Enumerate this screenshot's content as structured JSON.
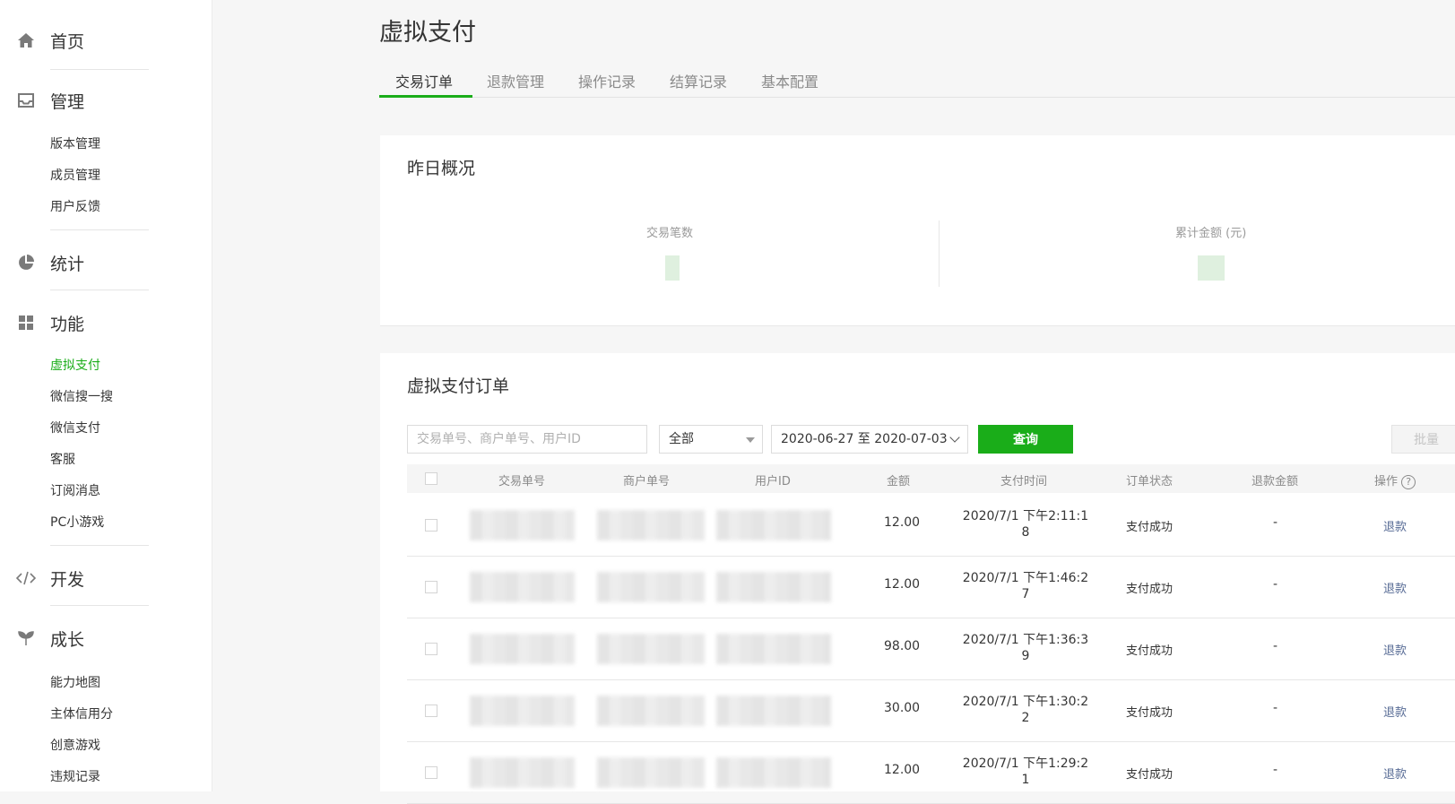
{
  "sidebar": {
    "home": {
      "label": "首页",
      "icon": "home-icon"
    },
    "manage": {
      "label": "管理",
      "icon": "inbox-icon",
      "items": [
        "版本管理",
        "成员管理",
        "用户反馈"
      ]
    },
    "stats": {
      "label": "统计",
      "icon": "pie-chart-icon"
    },
    "features": {
      "label": "功能",
      "icon": "grid-icon",
      "items": [
        "虚拟支付",
        "微信搜一搜",
        "微信支付",
        "客服",
        "订阅消息",
        "PC小游戏"
      ],
      "active": "虚拟支付"
    },
    "dev": {
      "label": "开发",
      "icon": "code-icon"
    },
    "growth": {
      "label": "成长",
      "icon": "sprout-icon",
      "items": [
        "能力地图",
        "主体信用分",
        "创意游戏",
        "违规记录"
      ]
    }
  },
  "page": {
    "title": "虚拟支付"
  },
  "tabs": [
    "交易订单",
    "退款管理",
    "操作记录",
    "结算记录",
    "基本配置"
  ],
  "overview": {
    "title": "昨日概况",
    "stats": [
      {
        "label": "交易笔数"
      },
      {
        "label": "累计金额 (元)"
      }
    ]
  },
  "orders": {
    "title": "虚拟支付订单",
    "search_placeholder": "交易单号、商户单号、用户ID",
    "status_filter": "全部",
    "date_range": "2020-06-27 至 2020-07-03",
    "query_label": "查询",
    "batch_label": "批量",
    "columns": [
      "交易单号",
      "商户单号",
      "用户ID",
      "金额",
      "支付时间",
      "订单状态",
      "退款金额",
      "操作"
    ],
    "rows": [
      {
        "amount": "12.00",
        "time_1": "2020/7/1 下午2:11:1",
        "time_2": "8",
        "status": "支付成功",
        "refund_amount": "-",
        "action": "退款"
      },
      {
        "amount": "12.00",
        "time_1": "2020/7/1 下午1:46:2",
        "time_2": "7",
        "status": "支付成功",
        "refund_amount": "-",
        "action": "退款"
      },
      {
        "amount": "98.00",
        "time_1": "2020/7/1 下午1:36:3",
        "time_2": "9",
        "status": "支付成功",
        "refund_amount": "-",
        "action": "退款"
      },
      {
        "amount": "30.00",
        "time_1": "2020/7/1 下午1:30:2",
        "time_2": "2",
        "status": "支付成功",
        "refund_amount": "-",
        "action": "退款"
      },
      {
        "amount": "12.00",
        "time_1": "2020/7/1 下午1:29:2",
        "time_2": "1",
        "status": "支付成功",
        "refund_amount": "-",
        "action": "退款"
      }
    ]
  },
  "colors": {
    "accent": "#1aad19",
    "link": "#576b95"
  }
}
